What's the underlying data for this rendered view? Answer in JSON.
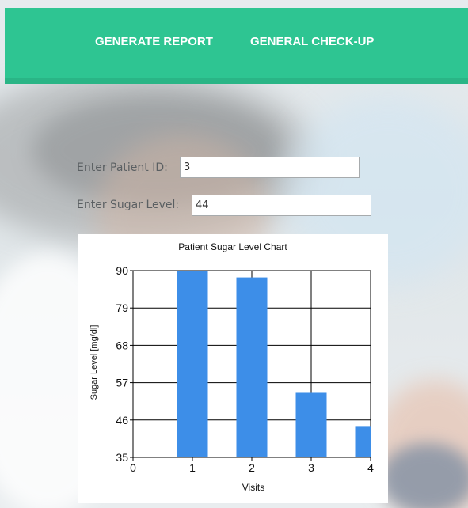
{
  "nav": {
    "generate_report": "GENERATE REPORT",
    "general_checkup": "GENERAL CHECK-UP"
  },
  "form": {
    "patient_id_label": "Enter Patient ID:",
    "patient_id_value": "3",
    "sugar_level_label": "Enter Sugar Level:",
    "sugar_level_value": "44"
  },
  "colors": {
    "topbar": "#2ec592",
    "bar_fill": "#3d8ee8"
  },
  "chart_data": {
    "type": "bar",
    "title": "Patient Sugar Level Chart",
    "xlabel": "Visits",
    "ylabel": "Sugar Level [mg/dl]",
    "x": [
      1,
      2,
      3,
      4
    ],
    "values": [
      90,
      88,
      54,
      44
    ],
    "xlim": [
      0,
      4
    ],
    "ylim": [
      35,
      90
    ],
    "yticks": [
      35,
      46,
      57,
      68,
      79,
      90
    ],
    "xticks": [
      0,
      1,
      2,
      3,
      4
    ],
    "grid": true
  }
}
